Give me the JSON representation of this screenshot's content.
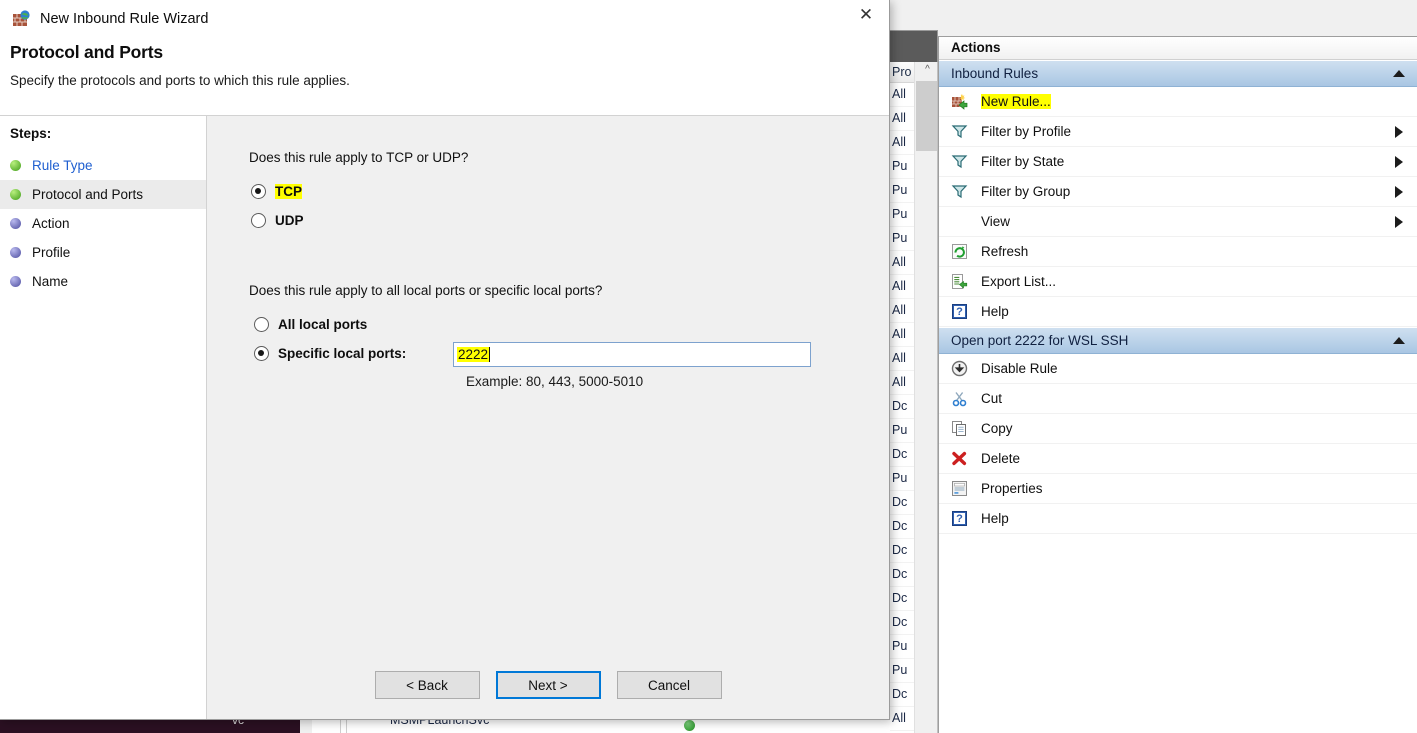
{
  "wizard": {
    "title": "New Inbound Rule Wizard",
    "icon": "firewall-brick-globe-icon",
    "close_label": "✕",
    "page_heading": "Protocol and Ports",
    "page_subtitle": "Specify the protocols and ports to which this rule applies.",
    "steps_header": "Steps:",
    "steps": [
      {
        "label": "Rule Type",
        "state": "done",
        "current": false
      },
      {
        "label": "Protocol and Ports",
        "state": "done",
        "current": true
      },
      {
        "label": "Action",
        "state": "todo",
        "current": false
      },
      {
        "label": "Profile",
        "state": "todo",
        "current": false
      },
      {
        "label": "Name",
        "state": "todo",
        "current": false
      }
    ],
    "protocol_question": "Does this rule apply to TCP or UDP?",
    "protocol_options": [
      {
        "label": "TCP",
        "selected": true,
        "highlighted": true
      },
      {
        "label": "UDP",
        "selected": false,
        "highlighted": false
      }
    ],
    "ports_question": "Does this rule apply to all local ports or specific local ports?",
    "ports_options": [
      {
        "label": "All local ports",
        "selected": false
      },
      {
        "label": "Specific local ports:",
        "selected": true
      }
    ],
    "ports_value": "2222",
    "ports_example": "Example: 80, 443, 5000-5010",
    "buttons": [
      {
        "label": "< Back",
        "focused": false
      },
      {
        "label": "Next >",
        "focused": true
      },
      {
        "label": "Cancel",
        "focused": false
      }
    ]
  },
  "actions_pane": {
    "title": "Actions",
    "groups": [
      {
        "header": "Inbound Rules",
        "collapse_icon": "chevron-up-icon",
        "items": [
          {
            "label": "New Rule...",
            "icon": "new-rule-icon",
            "submenu": false,
            "highlighted": true
          },
          {
            "label": "Filter by Profile",
            "icon": "filter-icon",
            "submenu": true,
            "highlighted": false
          },
          {
            "label": "Filter by State",
            "icon": "filter-icon",
            "submenu": true,
            "highlighted": false
          },
          {
            "label": "Filter by Group",
            "icon": "filter-icon",
            "submenu": true,
            "highlighted": false
          },
          {
            "label": "View",
            "icon": "none",
            "submenu": true,
            "highlighted": false
          },
          {
            "label": "Refresh",
            "icon": "refresh-icon",
            "submenu": false,
            "highlighted": false
          },
          {
            "label": "Export List...",
            "icon": "export-list-icon",
            "submenu": false,
            "highlighted": false
          },
          {
            "label": "Help",
            "icon": "help-icon",
            "submenu": false,
            "highlighted": false
          }
        ]
      },
      {
        "header": "Open port 2222 for WSL SSH",
        "collapse_icon": "chevron-up-icon",
        "items": [
          {
            "label": "Disable Rule",
            "icon": "disable-rule-icon",
            "submenu": false,
            "highlighted": false
          },
          {
            "label": "Cut",
            "icon": "cut-icon",
            "submenu": false,
            "highlighted": false
          },
          {
            "label": "Copy",
            "icon": "copy-icon",
            "submenu": false,
            "highlighted": false
          },
          {
            "label": "Delete",
            "icon": "delete-icon",
            "submenu": false,
            "highlighted": false
          },
          {
            "label": "Properties",
            "icon": "properties-icon",
            "submenu": false,
            "highlighted": false
          },
          {
            "label": "Help",
            "icon": "help-icon",
            "submenu": false,
            "highlighted": false
          }
        ]
      }
    ]
  },
  "background_list": {
    "column_header": "Pro",
    "scroll_up_icon": "chevron-up-icon",
    "rows": [
      "All",
      "All",
      "All",
      "Pu",
      "Pu",
      "Pu",
      "Pu",
      "All",
      "All",
      "All",
      "All",
      "All",
      "All",
      "Dc",
      "Pu",
      "Dc",
      "Pu",
      "Dc",
      "Dc",
      "Dc",
      "Dc",
      "Dc",
      "Dc",
      "Pu",
      "Pu",
      "Dc",
      "All"
    ]
  },
  "bottom_strip": {
    "service_name": "MSMPLaunchSvc",
    "left_fragment": "vc"
  }
}
